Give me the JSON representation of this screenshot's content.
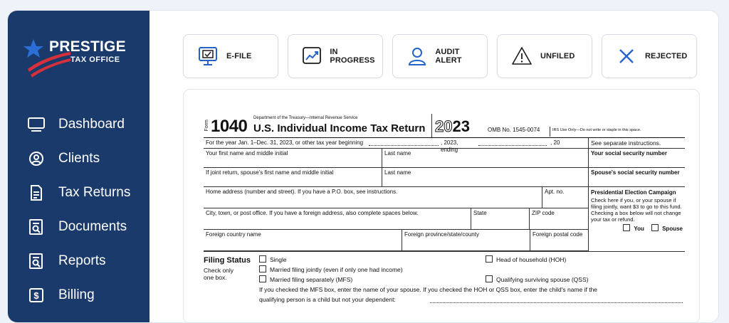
{
  "brand": {
    "name_line1": "PRESTIGE",
    "name_line2": "TAX OFFICE"
  },
  "sidebar": {
    "items": [
      {
        "label": "Dashboard",
        "icon": "monitor-icon"
      },
      {
        "label": "Clients",
        "icon": "user-circle-icon"
      },
      {
        "label": "Tax Returns",
        "icon": "document-lines-icon"
      },
      {
        "label": "Documents",
        "icon": "document-search-icon"
      },
      {
        "label": "Reports",
        "icon": "report-search-icon"
      },
      {
        "label": "Billing",
        "icon": "dollar-bill-icon"
      }
    ]
  },
  "status": [
    {
      "label": "E-FILE",
      "icon": "computer-check-icon"
    },
    {
      "label": "IN PROGRESS",
      "icon": "trend-chart-icon"
    },
    {
      "label": "AUDIT ALERT",
      "icon": "person-icon"
    },
    {
      "label": "UNFILED",
      "icon": "warning-triangle-icon"
    },
    {
      "label": "REJECTED",
      "icon": "x-icon"
    }
  ],
  "colors": {
    "sidebar": "#1a3a6b",
    "accent_blue": "#2563c9",
    "logo_red": "#d6303a"
  },
  "form1040": {
    "form_label": "Form",
    "form_number": "1040",
    "dept": "Department of the Treasury—Internal Revenue Service",
    "title": "U.S. Individual Income Tax Return",
    "year_prefix": "20",
    "year_suffix": "23",
    "omb": "OMB No. 1545-0074",
    "irs_use": "IRS Use Only—Do not write or staple in this space.",
    "tax_year_line": "For the year Jan. 1–Dec. 31, 2023, or other tax year beginning",
    "ending": ", 2023, ending",
    "ending_20": ", 20",
    "see_instructions": "See separate instructions.",
    "first_name": "Your first name and middle initial",
    "last_name": "Last name",
    "ssn": "Your social security number",
    "spouse_first": "If joint return, spouse's first name and middle initial",
    "spouse_last": "Last name",
    "spouse_ssn": "Spouse's social security number",
    "home_address": "Home address (number and street). If you have a P.O. box, see instructions.",
    "apt": "Apt. no.",
    "pec_title": "Presidential Election Campaign",
    "pec_text": "Check here if you, or your spouse if filing jointly, want $3 to go to this fund. Checking a box below will not change your tax or refund.",
    "pec_you": "You",
    "pec_spouse": "Spouse",
    "city": "City, town, or post office. If you have a foreign address, also complete spaces below.",
    "state": "State",
    "zip": "ZIP code",
    "foreign_country": "Foreign country name",
    "foreign_province": "Foreign province/state/county",
    "foreign_postal": "Foreign postal code",
    "filing_status": "Filing Status",
    "check_only": "Check only one box.",
    "fs_single": "Single",
    "fs_mfj": "Married filing jointly (even if only one had income)",
    "fs_mfs": "Married filing separately (MFS)",
    "fs_hoh": "Head of household (HOH)",
    "fs_qss": "Qualifying surviving spouse (QSS)",
    "fs_note1": "If you checked the MFS box, enter the name of your spouse. If you checked the HOH or QSS box, enter the child's name if the",
    "fs_note2": "qualifying person is a child but not your dependent:"
  }
}
